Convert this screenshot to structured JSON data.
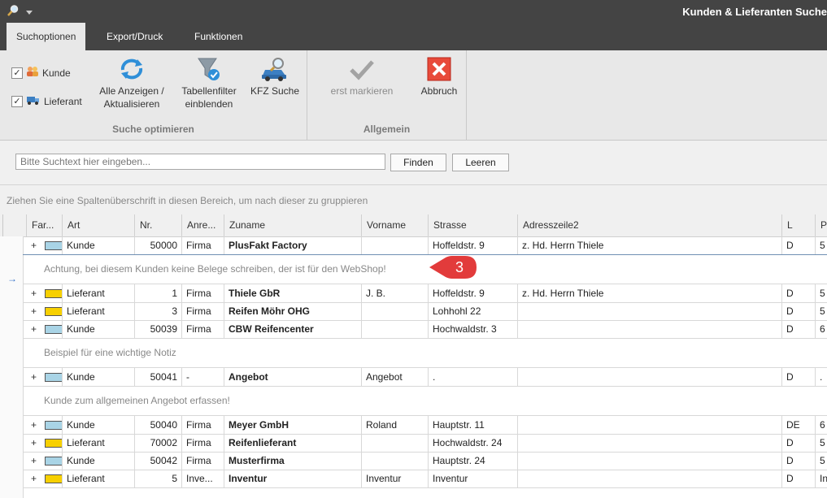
{
  "window": {
    "title": "Kunden & Lieferanten Suche"
  },
  "tabs": [
    "Suchoptionen",
    "Export/Druck",
    "Funktionen"
  ],
  "ribbon": {
    "filters": [
      {
        "label": "Kunde",
        "checked": true,
        "icon": "people-icon"
      },
      {
        "label": "Lieferant",
        "checked": true,
        "icon": "truck-icon"
      }
    ],
    "buttons": [
      {
        "line1": "Alle Anzeigen /",
        "line2": "Aktualisieren",
        "icon": "refresh-icon"
      },
      {
        "line1": "Tabellenfilter",
        "line2": "einblenden",
        "icon": "funnel-icon"
      },
      {
        "line1": "KFZ Suche",
        "line2": "",
        "icon": "car-search-icon"
      },
      {
        "line1": "erst markieren",
        "line2": "",
        "icon": "checkmark-icon",
        "disabled": true
      },
      {
        "line1": "Abbruch",
        "line2": "",
        "icon": "cancel-icon"
      }
    ],
    "groups": [
      "Suche optimieren",
      "Allgemein"
    ]
  },
  "search": {
    "placeholder": "Bitte Suchtext hier eingeben...",
    "value": "",
    "find_label": "Finden",
    "clear_label": "Leeren"
  },
  "group_hint": "Ziehen Sie eine Spaltenüberschrift in diesen Bereich, um nach dieser zu gruppieren",
  "columns": [
    "Far...",
    "Art",
    "Nr.",
    "Anre...",
    "Zuname",
    "Vorname",
    "Strasse",
    "Adresszeile2",
    "L",
    "P"
  ],
  "rows": [
    {
      "color": "#a9d4e6",
      "art": "Kunde",
      "nr": "50000",
      "anrede": "Firma",
      "zuname": "PlusFakt Factory",
      "vorname": "",
      "strasse": "Hoffeldstr. 9",
      "adresse2": "z. Hd. Herrn Thiele",
      "land": "D",
      "plz": "5"
    },
    {
      "note": "Achtung, bei diesem Kunden keine Belege schreiben, der ist für den WebShop!"
    },
    {
      "color": "#f7d000",
      "art": "Lieferant",
      "nr": "1",
      "anrede": "Firma",
      "zuname": "Thiele GbR",
      "vorname": "J. B.",
      "strasse": "Hoffeldstr. 9",
      "adresse2": "z. Hd. Herrn Thiele",
      "land": "D",
      "plz": "5"
    },
    {
      "color": "#f7d000",
      "art": "Lieferant",
      "nr": "3",
      "anrede": "Firma",
      "zuname": "Reifen Möhr OHG",
      "vorname": "",
      "strasse": "Lohhohl 22",
      "adresse2": "",
      "land": "D",
      "plz": "5"
    },
    {
      "color": "#a9d4e6",
      "art": "Kunde",
      "nr": "50039",
      "anrede": "Firma",
      "zuname": "CBW Reifencenter",
      "vorname": "",
      "strasse": "Hochwaldstr. 3",
      "adresse2": "",
      "land": "D",
      "plz": "6"
    },
    {
      "note": "Beispiel für eine wichtige Notiz"
    },
    {
      "color": "#a9d4e6",
      "art": "Kunde",
      "nr": "50041",
      "anrede": "-",
      "zuname": "Angebot",
      "vorname": "Angebot",
      "strasse": ".",
      "adresse2": "",
      "land": "D",
      "plz": "."
    },
    {
      "note": "Kunde zum allgemeinen Angebot erfassen!"
    },
    {
      "color": "#a9d4e6",
      "art": "Kunde",
      "nr": "50040",
      "anrede": "Firma",
      "zuname": "Meyer GmbH",
      "vorname": "Roland",
      "strasse": "Hauptstr. 11",
      "adresse2": "",
      "land": "DE",
      "plz": "6"
    },
    {
      "color": "#f7d000",
      "art": "Lieferant",
      "nr": "70002",
      "anrede": "Firma",
      "zuname": "Reifenlieferant",
      "vorname": "",
      "strasse": "Hochwaldstr. 24",
      "adresse2": "",
      "land": "D",
      "plz": "5"
    },
    {
      "color": "#a9d4e6",
      "art": "Kunde",
      "nr": "50042",
      "anrede": "Firma",
      "zuname": "Musterfirma",
      "vorname": "",
      "strasse": "Hauptstr. 24",
      "adresse2": "",
      "land": "D",
      "plz": "5"
    },
    {
      "color": "#f7d000",
      "art": "Lieferant",
      "nr": "5",
      "anrede": "Inve...",
      "zuname": "Inventur",
      "vorname": "Inventur",
      "strasse": "Inventur",
      "adresse2": "",
      "land": "D",
      "plz": "In"
    }
  ],
  "callout": {
    "number": "3",
    "color": "#e23b3b"
  }
}
